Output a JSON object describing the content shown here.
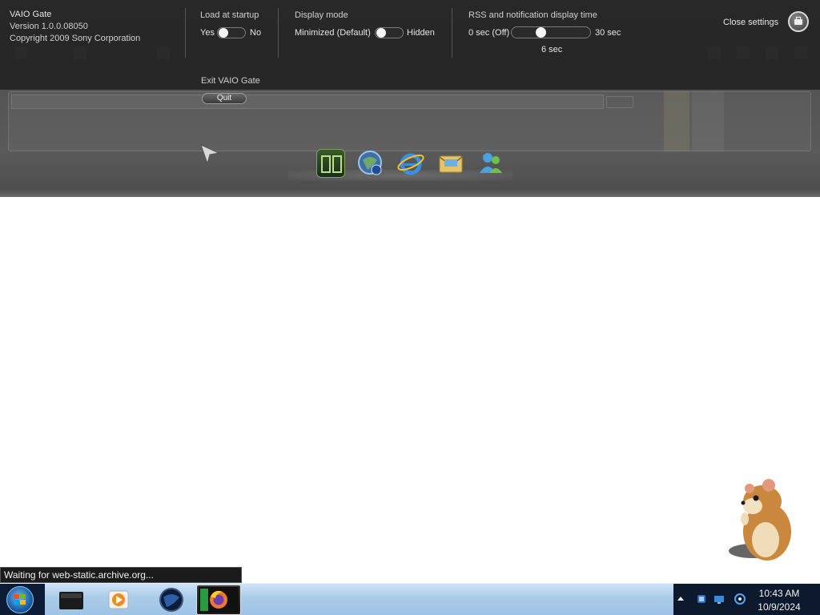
{
  "vaio_gate": {
    "app_name": "VAIO Gate",
    "version": "Version 1.0.0.08050",
    "copyright": "Copyright 2009 Sony Corporation",
    "load_at_startup": {
      "label": "Load at startup",
      "left_label": "Yes",
      "right_label": "No",
      "value": "Yes"
    },
    "display_mode": {
      "label": "Display mode",
      "left_label": "Minimized (Default)",
      "right_label": "Hidden",
      "value": "Minimized (Default)"
    },
    "rss_time": {
      "label": "RSS and notification display time",
      "min_label": "0 sec (Off)",
      "max_label": "30 sec",
      "value_label": "6 sec",
      "value": 6,
      "min": 0,
      "max": 30
    },
    "exit": {
      "label": "Exit VAIO Gate",
      "button": "Quit"
    },
    "close_settings": "Close settings",
    "close_settings_icon": "briefcase-icon"
  },
  "dock": {
    "items": [
      {
        "name": "media-app-icon"
      },
      {
        "name": "world-clock-icon"
      },
      {
        "name": "internet-explorer-icon"
      },
      {
        "name": "mail-icon"
      },
      {
        "name": "messenger-icon"
      }
    ]
  },
  "status_text": "Waiting for web-static.archive.org...",
  "taskbar": {
    "clock_time": "10:43 AM",
    "clock_date": "10/9/2024",
    "pinned": [
      "folder-icon",
      "media-player-icon",
      "globe-app-icon",
      "firefox-icon"
    ],
    "active": "firefox-icon"
  },
  "colors": {
    "settings_bg": "#1c1c1c",
    "taskbar": "#a9cbe8",
    "tray": "#0d1a2e"
  }
}
